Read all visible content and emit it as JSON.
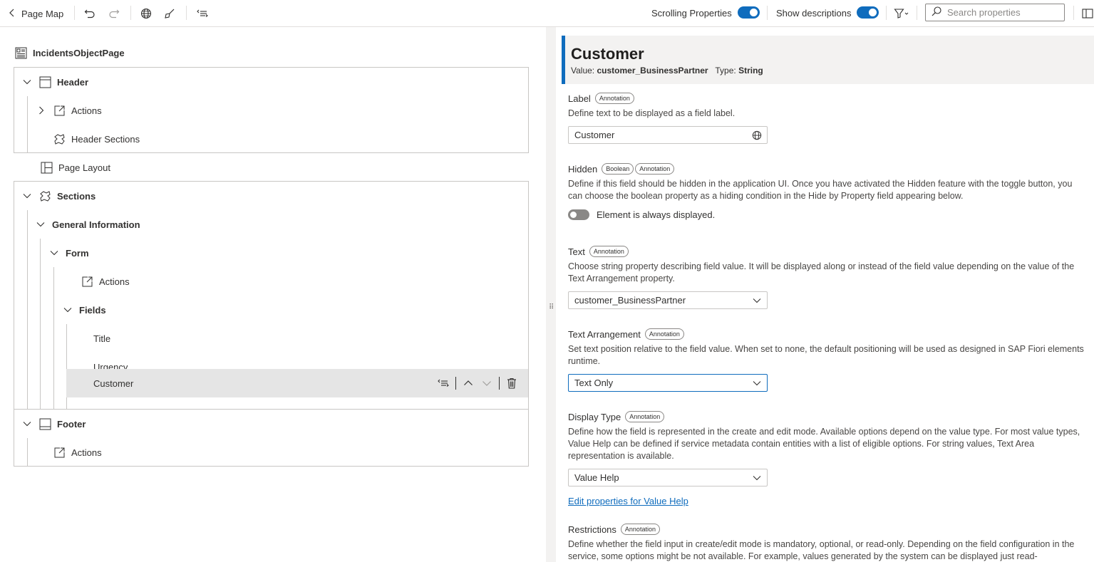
{
  "toolbar": {
    "back_label": "Page Map",
    "scrolling_label": "Scrolling Properties",
    "descriptions_label": "Show descriptions",
    "search_placeholder": "Search properties"
  },
  "tree": {
    "page_title": "IncidentsObjectPage",
    "header": "Header",
    "header_actions": "Actions",
    "header_sections": "Header Sections",
    "page_layout": "Page Layout",
    "sections": "Sections",
    "general_information": "General Information",
    "form": "Form",
    "form_actions": "Actions",
    "fields": "Fields",
    "field_title": "Title",
    "field_urgency": "Urgency",
    "field_customer": "Customer",
    "footer": "Footer",
    "footer_actions": "Actions"
  },
  "properties": {
    "title": "Customer",
    "value_label": "Value:",
    "value": "customer_BusinessPartner",
    "type_label": "Type:",
    "type": "String",
    "label": {
      "name": "Label",
      "badge": "Annotation",
      "desc": "Define text to be displayed as a field label.",
      "value": "Customer"
    },
    "hidden": {
      "name": "Hidden",
      "badge1": "Boolean",
      "badge2": "Annotation",
      "desc": "Define if this field should be hidden in the application UI. Once you have activated the Hidden feature with the toggle button, you can choose the boolean property as a hiding condition in the Hide by Property field appearing below.",
      "toggle_text": "Element is always displayed."
    },
    "text": {
      "name": "Text",
      "badge": "Annotation",
      "desc": "Choose string property describing field value. It will be displayed along or instead of the field value depending on the value of the Text Arrangement property.",
      "value": "customer_BusinessPartner"
    },
    "text_arrangement": {
      "name": "Text Arrangement",
      "badge": "Annotation",
      "desc": "Set text position relative to the field value. When set to none, the default positioning will be used as designed in SAP Fiori elements runtime.",
      "value": "Text Only"
    },
    "display_type": {
      "name": "Display Type",
      "badge": "Annotation",
      "desc": "Define how the field is represented in the create and edit mode. Available options depend on the value type. For most value types, Value Help can be defined if service metadata contain entities with a list of eligible options. For string values, Text Area representation is available.",
      "value": "Value Help",
      "link": "Edit properties for Value Help"
    },
    "restrictions": {
      "name": "Restrictions",
      "badge": "Annotation",
      "desc": "Define whether the field input in create/edit mode is mandatory, optional, or read-only. Depending on the field configuration in the service, some options might be not available. For example, values generated by the system can be displayed just read-"
    }
  },
  "colors": {
    "accent": "#0f6cbd",
    "selected_row": "#e5e5e5",
    "border": "#c8c6c4"
  }
}
